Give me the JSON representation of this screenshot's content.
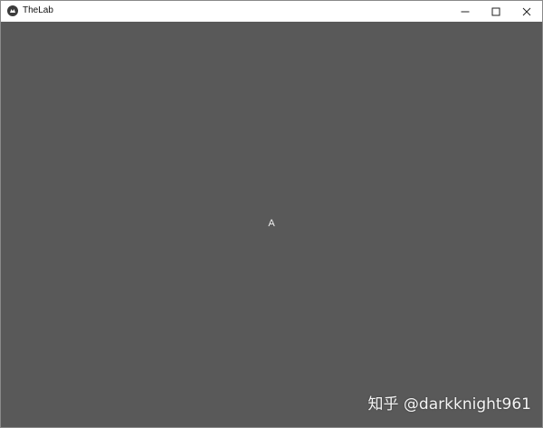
{
  "window": {
    "title": "TheLab",
    "app_icon": "kivy-logo-icon",
    "controls": {
      "minimize_icon": "minimize-icon",
      "maximize_icon": "maximize-icon",
      "close_icon": "close-icon"
    }
  },
  "content": {
    "label": "A",
    "background_color": "#595959",
    "text_color": "#f2f2f2"
  },
  "watermark": {
    "text": "知乎 @darkknight961"
  }
}
